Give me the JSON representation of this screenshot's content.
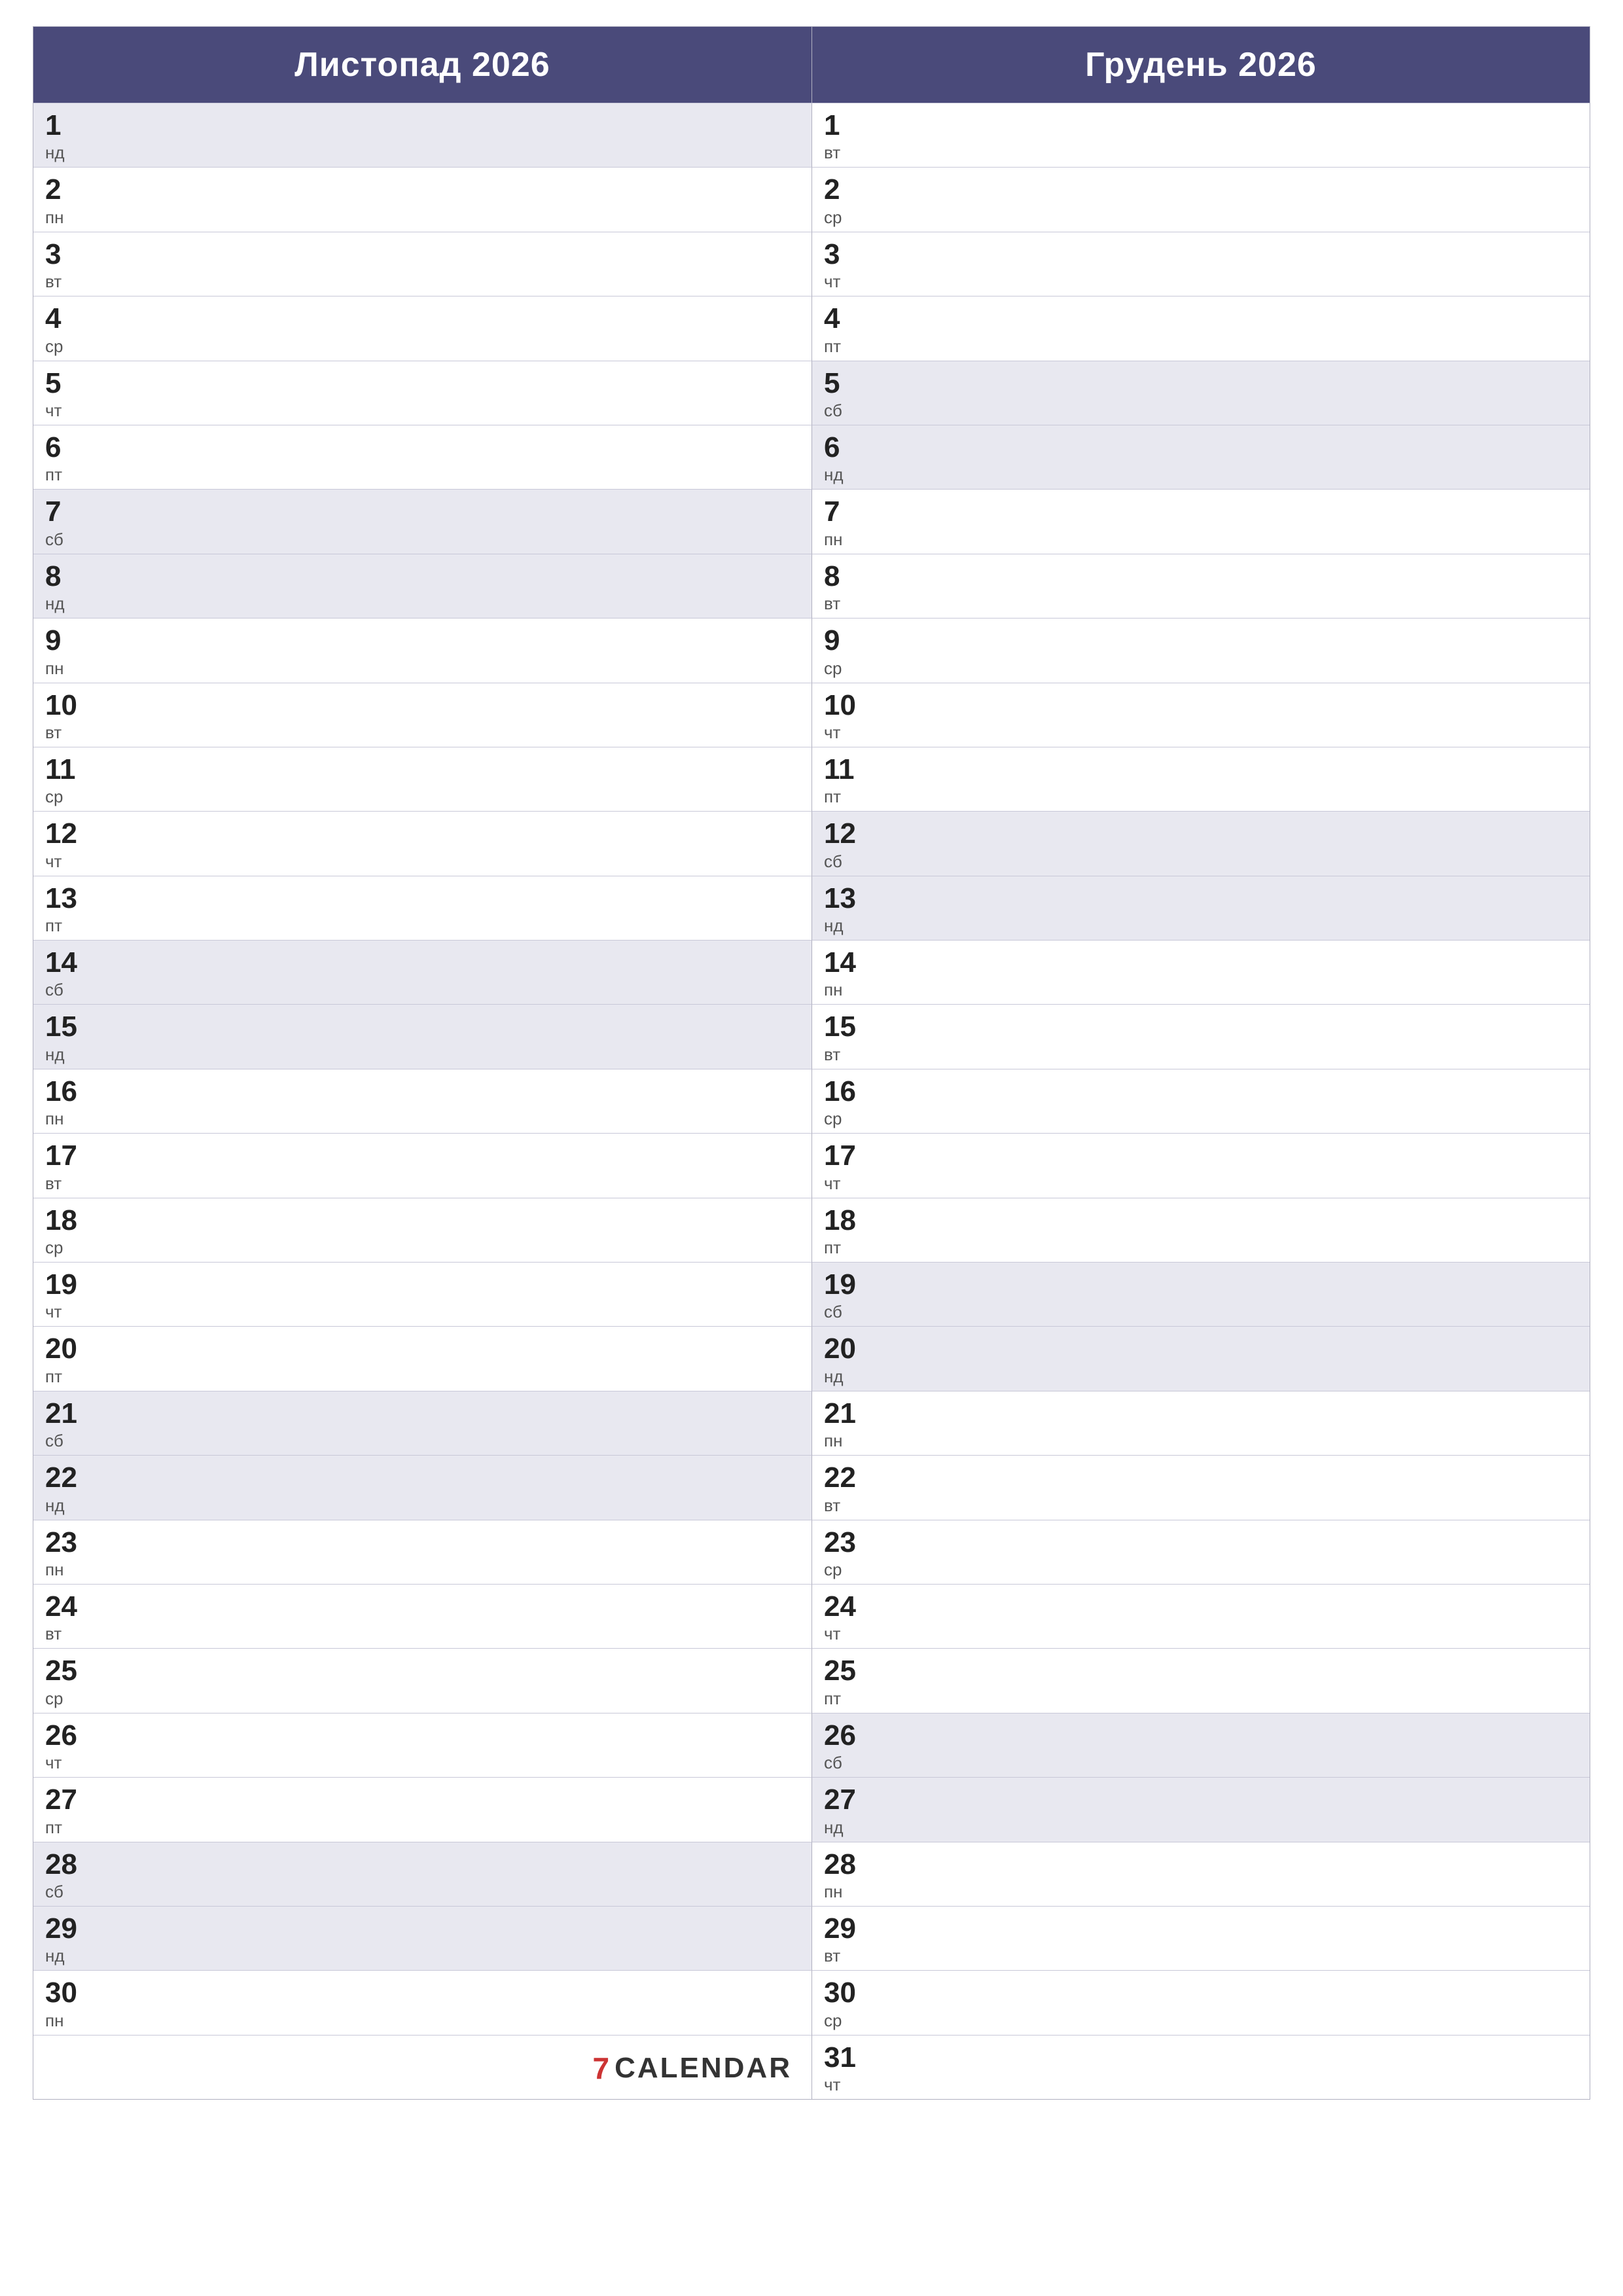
{
  "months": {
    "left": {
      "title": "Листопад 2026",
      "days": [
        {
          "num": "1",
          "name": "нд",
          "weekend": true
        },
        {
          "num": "2",
          "name": "пн",
          "weekend": false
        },
        {
          "num": "3",
          "name": "вт",
          "weekend": false
        },
        {
          "num": "4",
          "name": "ср",
          "weekend": false
        },
        {
          "num": "5",
          "name": "чт",
          "weekend": false
        },
        {
          "num": "6",
          "name": "пт",
          "weekend": false
        },
        {
          "num": "7",
          "name": "сб",
          "weekend": true
        },
        {
          "num": "8",
          "name": "нд",
          "weekend": true
        },
        {
          "num": "9",
          "name": "пн",
          "weekend": false
        },
        {
          "num": "10",
          "name": "вт",
          "weekend": false
        },
        {
          "num": "11",
          "name": "ср",
          "weekend": false
        },
        {
          "num": "12",
          "name": "чт",
          "weekend": false
        },
        {
          "num": "13",
          "name": "пт",
          "weekend": false
        },
        {
          "num": "14",
          "name": "сб",
          "weekend": true
        },
        {
          "num": "15",
          "name": "нд",
          "weekend": true
        },
        {
          "num": "16",
          "name": "пн",
          "weekend": false
        },
        {
          "num": "17",
          "name": "вт",
          "weekend": false
        },
        {
          "num": "18",
          "name": "ср",
          "weekend": false
        },
        {
          "num": "19",
          "name": "чт",
          "weekend": false
        },
        {
          "num": "20",
          "name": "пт",
          "weekend": false
        },
        {
          "num": "21",
          "name": "сб",
          "weekend": true
        },
        {
          "num": "22",
          "name": "нд",
          "weekend": true
        },
        {
          "num": "23",
          "name": "пн",
          "weekend": false
        },
        {
          "num": "24",
          "name": "вт",
          "weekend": false
        },
        {
          "num": "25",
          "name": "ср",
          "weekend": false
        },
        {
          "num": "26",
          "name": "чт",
          "weekend": false
        },
        {
          "num": "27",
          "name": "пт",
          "weekend": false
        },
        {
          "num": "28",
          "name": "сб",
          "weekend": true
        },
        {
          "num": "29",
          "name": "нд",
          "weekend": true
        },
        {
          "num": "30",
          "name": "пн",
          "weekend": false
        }
      ]
    },
    "right": {
      "title": "Грудень 2026",
      "days": [
        {
          "num": "1",
          "name": "вт",
          "weekend": false
        },
        {
          "num": "2",
          "name": "ср",
          "weekend": false
        },
        {
          "num": "3",
          "name": "чт",
          "weekend": false
        },
        {
          "num": "4",
          "name": "пт",
          "weekend": false
        },
        {
          "num": "5",
          "name": "сб",
          "weekend": true
        },
        {
          "num": "6",
          "name": "нд",
          "weekend": true
        },
        {
          "num": "7",
          "name": "пн",
          "weekend": false
        },
        {
          "num": "8",
          "name": "вт",
          "weekend": false
        },
        {
          "num": "9",
          "name": "ср",
          "weekend": false
        },
        {
          "num": "10",
          "name": "чт",
          "weekend": false
        },
        {
          "num": "11",
          "name": "пт",
          "weekend": false
        },
        {
          "num": "12",
          "name": "сб",
          "weekend": true
        },
        {
          "num": "13",
          "name": "нд",
          "weekend": true
        },
        {
          "num": "14",
          "name": "пн",
          "weekend": false
        },
        {
          "num": "15",
          "name": "вт",
          "weekend": false
        },
        {
          "num": "16",
          "name": "ср",
          "weekend": false
        },
        {
          "num": "17",
          "name": "чт",
          "weekend": false
        },
        {
          "num": "18",
          "name": "пт",
          "weekend": false
        },
        {
          "num": "19",
          "name": "сб",
          "weekend": true
        },
        {
          "num": "20",
          "name": "нд",
          "weekend": true
        },
        {
          "num": "21",
          "name": "пн",
          "weekend": false
        },
        {
          "num": "22",
          "name": "вт",
          "weekend": false
        },
        {
          "num": "23",
          "name": "ср",
          "weekend": false
        },
        {
          "num": "24",
          "name": "чт",
          "weekend": false
        },
        {
          "num": "25",
          "name": "пт",
          "weekend": false
        },
        {
          "num": "26",
          "name": "сб",
          "weekend": true
        },
        {
          "num": "27",
          "name": "нд",
          "weekend": true
        },
        {
          "num": "28",
          "name": "пн",
          "weekend": false
        },
        {
          "num": "29",
          "name": "вт",
          "weekend": false
        },
        {
          "num": "30",
          "name": "ср",
          "weekend": false
        },
        {
          "num": "31",
          "name": "чт",
          "weekend": false
        }
      ]
    }
  },
  "footer": {
    "logo_text": "CALENDAR",
    "logo_number": "7"
  }
}
